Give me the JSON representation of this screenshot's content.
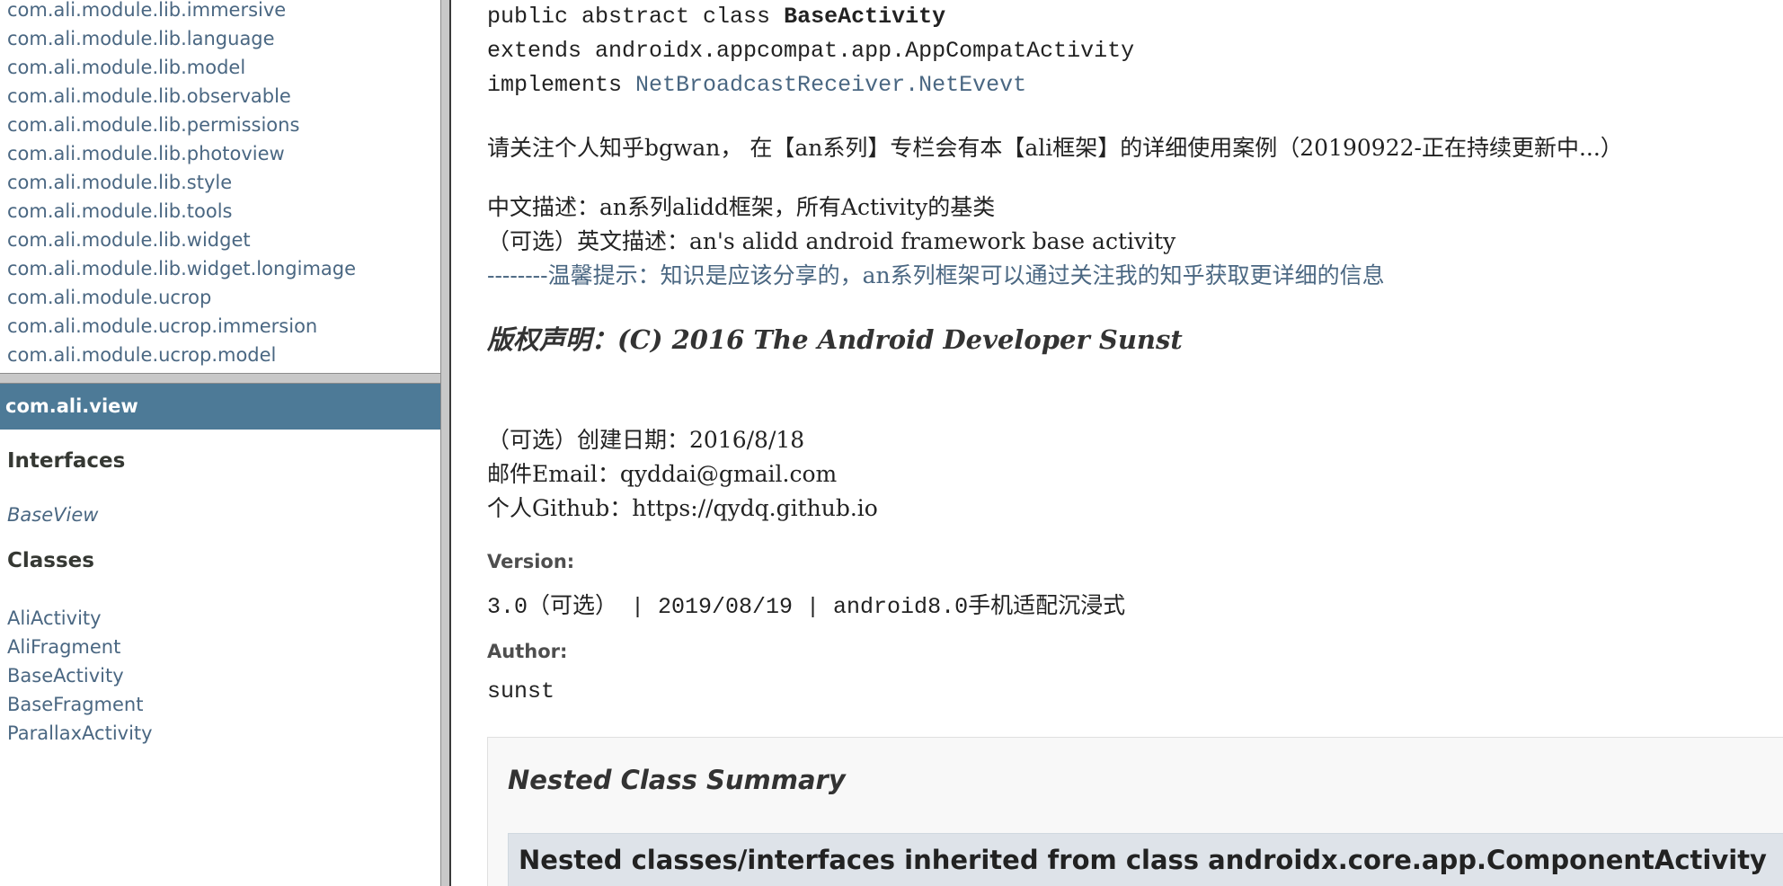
{
  "packages": [
    "com.ali.module.lib.immersive",
    "com.ali.module.lib.language",
    "com.ali.module.lib.model",
    "com.ali.module.lib.observable",
    "com.ali.module.lib.permissions",
    "com.ali.module.lib.photoview",
    "com.ali.module.lib.style",
    "com.ali.module.lib.tools",
    "com.ali.module.lib.widget",
    "com.ali.module.lib.widget.longimage",
    "com.ali.module.ucrop",
    "com.ali.module.ucrop.immersion",
    "com.ali.module.ucrop.model"
  ],
  "package_frame": {
    "title": "com.ali.view",
    "interfaces_label": "Interfaces",
    "interfaces": [
      "BaseView"
    ],
    "classes_label": "Classes",
    "classes": [
      "AliActivity",
      "AliFragment",
      "BaseActivity",
      "BaseFragment",
      "ParallaxActivity"
    ]
  },
  "class_doc": {
    "signature": {
      "modifiers": "public abstract class ",
      "name": "BaseActivity",
      "extends": "extends androidx.appcompat.app.AppCompatActivity",
      "implements_prefix": "implements ",
      "implements_link": "NetBroadcastReceiver.NetEvevt"
    },
    "notice": "请关注个人知乎bgwan， 在【an系列】专栏会有本【ali框架】的详细使用案例（20190922-正在持续更新中...）",
    "desc_cn": "中文描述：an系列alidd框架，所有Activity的基类",
    "desc_en": "（可选）英文描述：an's alidd android framework base activity",
    "tip": "--------温馨提示：知识是应该分享的，an系列框架可以通过关注我的知乎获取更详细的信息",
    "copyright": "版权声明：(C) 2016 The Android Developer Sunst",
    "create_date": "（可选）创建日期：2016/8/18",
    "email": "邮件Email：qyddai@gmail.com",
    "github": "个人Github：https://qydq.github.io",
    "version_label": "Version:",
    "version": "3.0（可选） | 2019/08/19 | android8.0手机适配沉浸式",
    "author_label": "Author:",
    "author": "sunst",
    "nested_summary_title": "Nested Class Summary",
    "nested_inherited": "Nested classes/interfaces inherited from class androidx.core.app.ComponentActivity"
  }
}
